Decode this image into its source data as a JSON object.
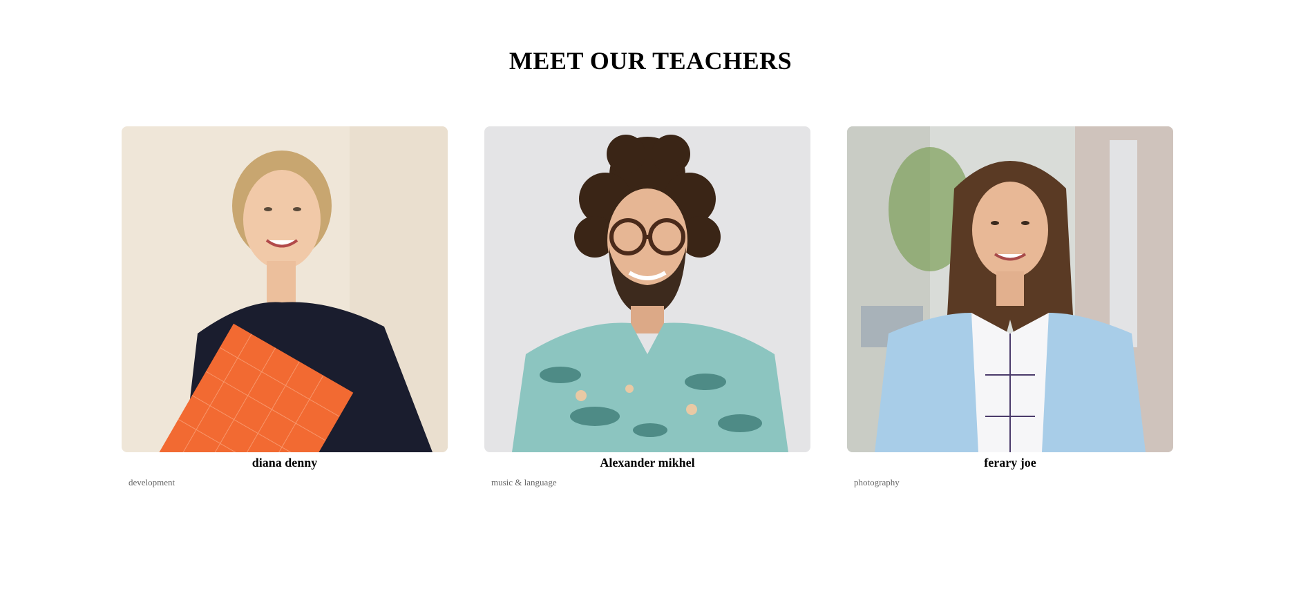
{
  "section": {
    "title": "MEET OUR TEACHERS"
  },
  "teachers": [
    {
      "name": "diana denny",
      "subject": "development",
      "photo_icon": "woman-with-orange-folder-photo",
      "photo_bg": "#efe6d8"
    },
    {
      "name": "Alexander mikhel",
      "subject": "music & language",
      "photo_icon": "curly-haired-man-with-glasses-photo",
      "photo_bg": "#e4e4e6"
    },
    {
      "name": "ferary joe",
      "subject": "photography",
      "photo_icon": "long-haired-woman-street-photo",
      "photo_bg": "#d9dcd8"
    }
  ]
}
